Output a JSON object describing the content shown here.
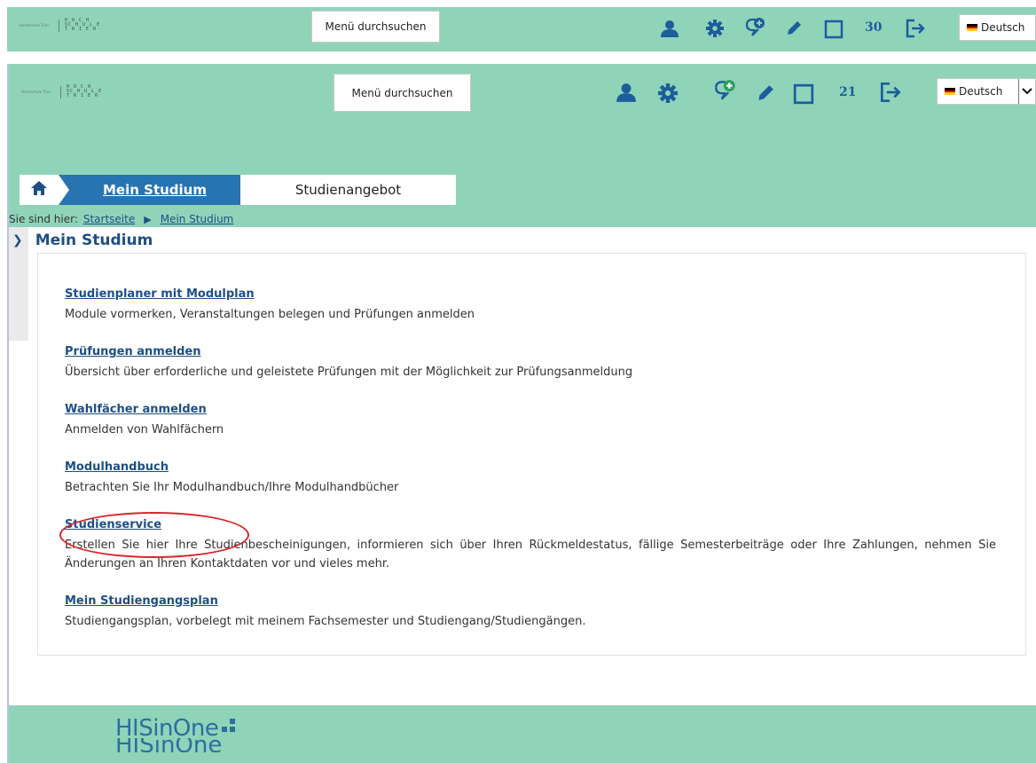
{
  "header_old": {
    "search_label": "Menü durchsuchen",
    "count": "30",
    "language": "Deutsch"
  },
  "header_new": {
    "search_label": "Menü durchsuchen",
    "count": "21",
    "language": "Deutsch"
  },
  "logo": {
    "small_text": "Hochschule Trier",
    "big_text": "H O C H\nSC H U L E\nT R I E R"
  },
  "nav": {
    "tabs": [
      {
        "label": "Mein Studium",
        "active": true
      },
      {
        "label": "Studienangebot",
        "active": false
      }
    ]
  },
  "breadcrumb": {
    "prefix": "Sie sind hier:",
    "items": [
      "Startseite",
      "Mein Studium"
    ]
  },
  "page_title": "Mein Studium",
  "items": [
    {
      "link": "Studienplaner mit Modulplan",
      "desc": "Module vormerken, Veranstaltungen belegen und Prüfungen anmelden"
    },
    {
      "link": "Prüfungen anmelden",
      "desc": "Übersicht über erforderliche und geleistete Prüfungen mit der Möglichkeit zur Prüfungsanmeldung"
    },
    {
      "link": "Wahlfächer anmelden",
      "desc": "Anmelden von Wahlfächern"
    },
    {
      "link": "Modulhandbuch",
      "desc": "Betrachten Sie Ihr Modulhandbuch/Ihre Modulhandbücher"
    },
    {
      "link": "Studienservice",
      "desc": "Erstellen Sie hier Ihre Studienbescheinigungen, informieren sich über Ihren Rückmeldestatus, fällige Semesterbeiträge oder Ihre Zahlungen, nehmen Sie Änderungen an Ihren Kontaktdaten vor und vieles mehr."
    },
    {
      "link": "Mein Studiengangsplan",
      "desc": "Studiengangsplan, vorbelegt mit meinem Fachsemester und Studiengang/Studiengängen."
    }
  ],
  "footer": {
    "brand": "HISinOne"
  },
  "colors": {
    "header_bg": "#8fd4b9",
    "accent_blue": "#1d5d9b",
    "active_tab": "#2874b0",
    "highlight_circle": "#d9262c"
  }
}
